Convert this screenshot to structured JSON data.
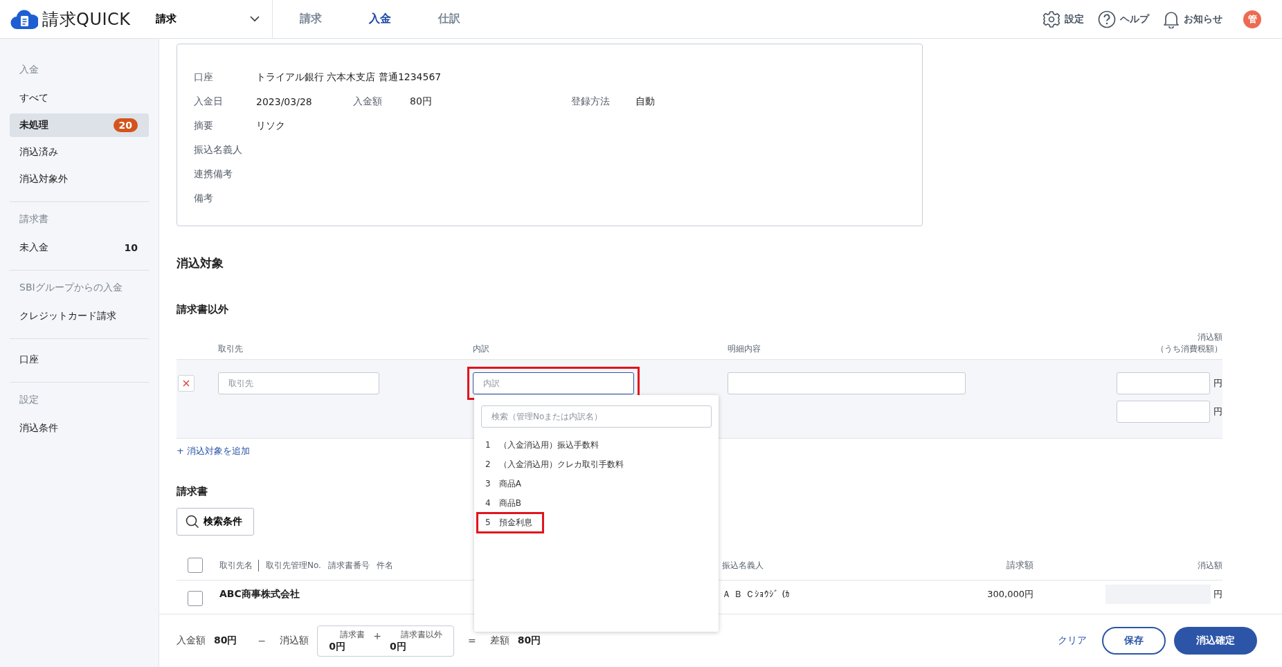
{
  "header": {
    "logo_text": "請求QUICK",
    "module_select": "請求",
    "nav_tabs": [
      {
        "label": "請求",
        "selected": false
      },
      {
        "label": "入金",
        "selected": true
      },
      {
        "label": "仕訳",
        "selected": false
      }
    ],
    "actions": [
      {
        "kind": "settings",
        "label": "設定"
      },
      {
        "kind": "help",
        "label": "ヘルプ"
      },
      {
        "kind": "notifications",
        "label": "お知らせ"
      }
    ],
    "avatar": "管"
  },
  "sidebar": {
    "sections": [
      {
        "heading": "入金",
        "items": [
          {
            "label": "すべて",
            "selected": false
          },
          {
            "label": "未処理",
            "selected": true,
            "badge": "20"
          },
          {
            "label": "消込済み",
            "selected": false
          },
          {
            "label": "消込対象外",
            "selected": false
          }
        ]
      },
      {
        "heading": "請求書",
        "items": [
          {
            "label": "未入金",
            "selected": false,
            "count": "10"
          }
        ]
      },
      {
        "heading": "SBIグループからの入金",
        "items": [
          {
            "label": "クレジットカード請求",
            "selected": false
          }
        ]
      },
      {
        "items": [
          {
            "label": "口座",
            "selected": false
          }
        ]
      },
      {
        "heading": "設定",
        "items": [
          {
            "label": "消込条件",
            "selected": false
          }
        ]
      }
    ]
  },
  "deposit_details": {
    "rows": [
      [
        {
          "label": "口座",
          "value": "トライアル銀行 六本木支店 普通1234567"
        }
      ],
      [
        {
          "label": "入金日",
          "value": "2023/03/28"
        },
        {
          "label": "入金額",
          "value": "80円"
        },
        {
          "label": "登録方法",
          "value": "自動"
        }
      ],
      [
        {
          "label": "摘要",
          "value": "リソク"
        }
      ],
      [
        {
          "label": "振込名義人"
        }
      ],
      [
        {
          "label": "連携備考"
        }
      ],
      [
        {
          "label": "備考"
        }
      ]
    ]
  },
  "reconciliation": {
    "title": "消込対象",
    "non_invoice": {
      "title": "請求書以外",
      "columns": [
        "取引先",
        "内訳",
        "明細内容"
      ],
      "amount_header": "消込額",
      "amount_subheader": "（うち消費税額）",
      "rows": [
        {
          "partner_placeholder": "取引先",
          "item_placeholder": "内訳",
          "item_focused": true,
          "item_annotated": true,
          "currency": "円",
          "tax_currency": "円"
        }
      ],
      "dropdown": {
        "search_placeholder": "検索（管理Noまたは内訳名）",
        "options": [
          {
            "no": "1",
            "name": "（入金消込用）振込手数料",
            "highlighted": false
          },
          {
            "no": "2",
            "name": "（入金消込用）クレカ取引手数料",
            "highlighted": false
          },
          {
            "no": "3",
            "name": "商品A",
            "highlighted": false
          },
          {
            "no": "4",
            "name": "商品B",
            "highlighted": false
          },
          {
            "no": "5",
            "name": "預金利息",
            "highlighted": true
          }
        ]
      },
      "add_link": "+ 消込対象を追加"
    },
    "invoices": {
      "title": "請求書",
      "search_button": "検索条件",
      "select_all_checked": false,
      "columns": [
        "取引先名",
        "取引先管理No.",
        "請求書番号",
        "件名",
        "振込名義人",
        "請求額",
        "消込額"
      ],
      "rows": [
        {
          "partner": "ABC商事株式会社",
          "payer_name": "Ａ Ｂ Ｃｼｮｳｼﾞ (ｶ",
          "amount": "300,000円",
          "currency": "円",
          "checked": false
        }
      ]
    }
  },
  "footer": {
    "deposit_label": "入金額",
    "deposit_value": "80円",
    "minus": "−",
    "applied_label": "消込額",
    "invoice_label": "請求書",
    "invoice_value": "0円",
    "plus": "+",
    "other_label": "請求書以外",
    "other_value": "0円",
    "equals": "=",
    "diff_label": "差額",
    "diff_value": "80円",
    "buttons": [
      {
        "kind": "link",
        "label": "クリア"
      },
      {
        "kind": "outline",
        "label": "保存"
      },
      {
        "kind": "primary",
        "label": "消込確定"
      }
    ]
  }
}
